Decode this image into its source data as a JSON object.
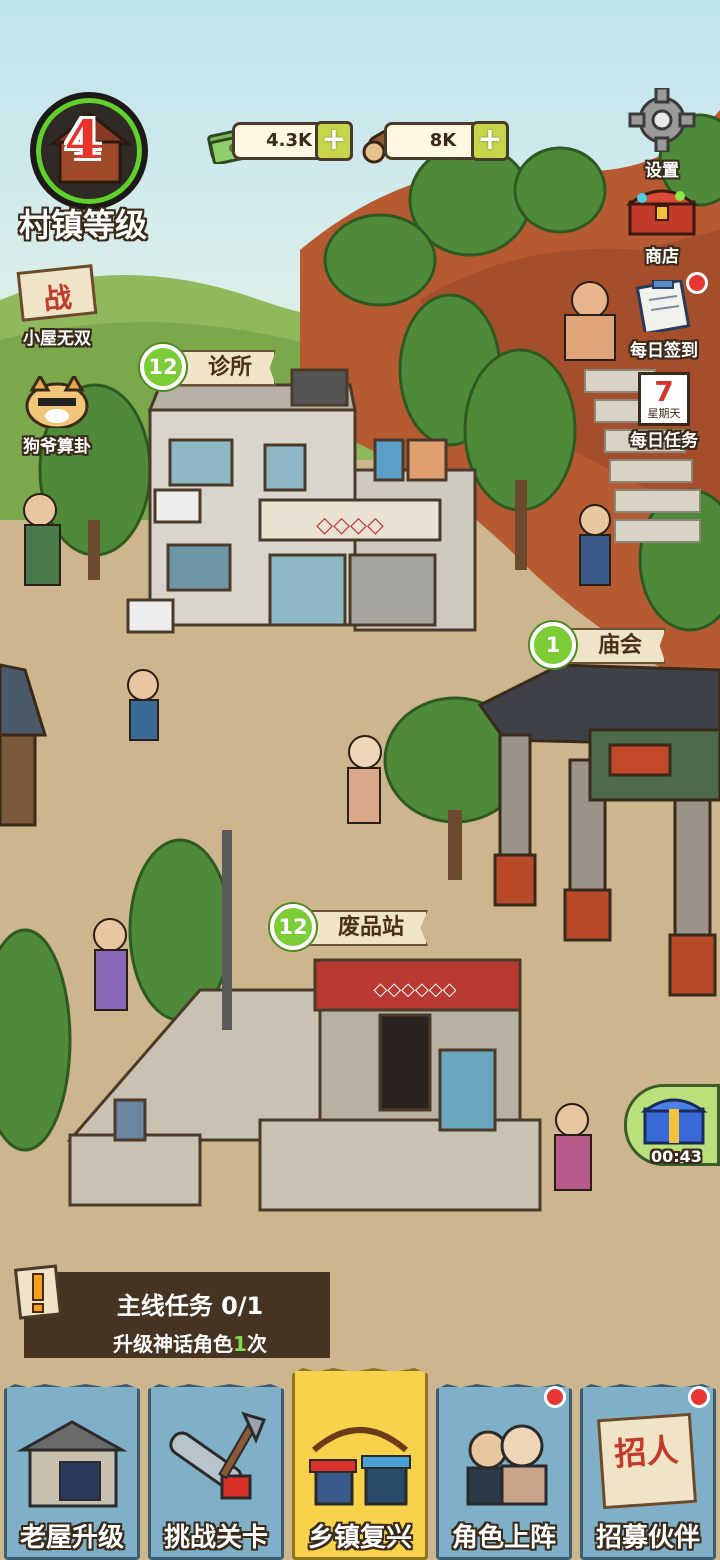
{
  "hud": {
    "village_level": {
      "level": "4",
      "label": "村镇等级"
    },
    "resources": [
      {
        "id": "cash",
        "value": "4.3K",
        "icon": "cash-icon"
      },
      {
        "id": "wood",
        "value": "8K",
        "icon": "log-icon"
      }
    ],
    "settings_label": "设置",
    "shop_label": "商店",
    "daily_signin_label": "每日签到",
    "daily_task_label": "每日任务",
    "calendar_day": "7",
    "calendar_weekday": "星期天",
    "battle_sign": "战",
    "battle_label": "小屋无双",
    "fortune_label": "狗爷算卦",
    "gift_timer": "00:43"
  },
  "buildings": [
    {
      "id": "clinic",
      "level": "12",
      "name": "诊所"
    },
    {
      "id": "temple_fair",
      "level": "1",
      "name": "庙会"
    },
    {
      "id": "scrapyard",
      "level": "12",
      "name": "废品站"
    }
  ],
  "main_task": {
    "title": "主线任务 0/1",
    "desc_prefix": "升级神话角色",
    "desc_count": "1",
    "desc_suffix": "次"
  },
  "bottom_nav": [
    {
      "id": "house",
      "label": "老屋升级",
      "active": false,
      "badge": false
    },
    {
      "id": "challenge",
      "label": "挑战关卡",
      "active": false,
      "badge": false
    },
    {
      "id": "revival",
      "label": "乡镇复兴",
      "active": true,
      "badge": false
    },
    {
      "id": "lineup",
      "label": "角色上阵",
      "active": false,
      "badge": true
    },
    {
      "id": "recruit",
      "label": "招募伙伴",
      "active": false,
      "badge": true,
      "poster_text": "招人"
    }
  ],
  "colors": {
    "sky": "#bfe0ea",
    "hill_green": "#7aa84a",
    "dirt": "#cdb68d",
    "level_ring": "#5fd12a",
    "tag_green": "#7ccc35",
    "nav_blue": "#7fb0c8",
    "nav_active": "#f7d24a",
    "badge_red": "#e83535"
  }
}
